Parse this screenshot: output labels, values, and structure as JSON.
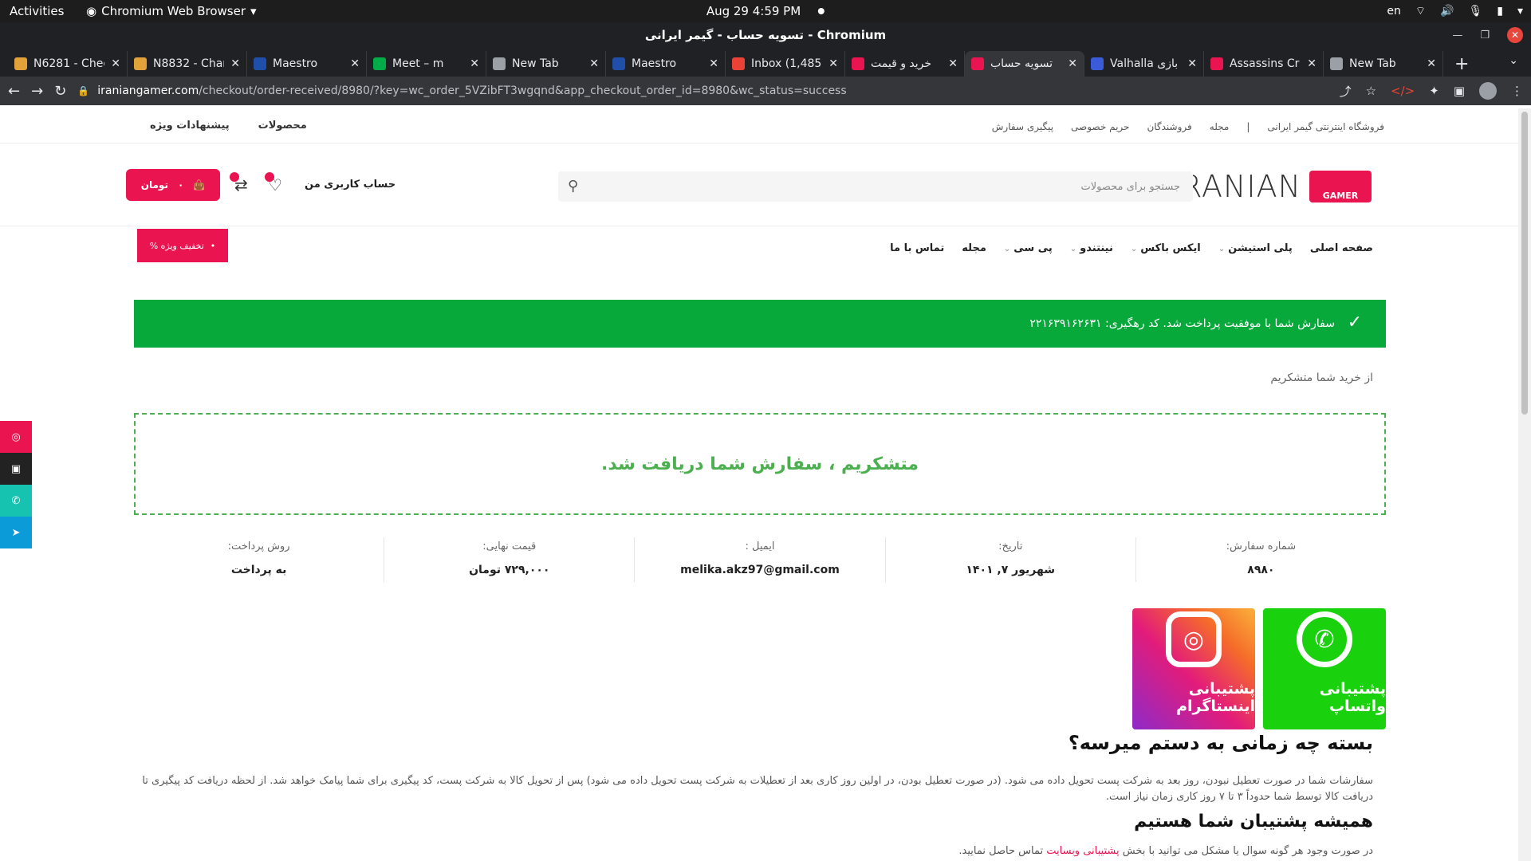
{
  "os_topbar": {
    "activities": "Activities",
    "app": "Chromium Web Browser",
    "clock": "Aug 29  4:59 PM",
    "lang": "en"
  },
  "window": {
    "title": "تسویه حساب - گیمر ایرانی - Chromium"
  },
  "tabs": [
    {
      "label": "N6281 - Chec",
      "color": "#e3a13a"
    },
    {
      "label": "N8832 - Char",
      "color": "#e3a13a"
    },
    {
      "label": "Maestro",
      "color": "#1f4fa8"
    },
    {
      "label": "Meet – m",
      "color": "#00ac47"
    },
    {
      "label": "New Tab",
      "color": "#9aa0a6"
    },
    {
      "label": "Maestro",
      "color": "#1f4fa8"
    },
    {
      "label": "Inbox (1,485",
      "color": "#ea4335"
    },
    {
      "label": "خرید و قیمت",
      "color": "#ea1450"
    },
    {
      "label": "تسویه حساب",
      "color": "#ea1450"
    },
    {
      "label": "Valhalla بازی",
      "color": "#3b5bdb"
    },
    {
      "label": "Assassins Cr",
      "color": "#ea1450"
    },
    {
      "label": "New Tab",
      "color": "#9aa0a6"
    }
  ],
  "omnibox": {
    "host": "iraniangamer.com",
    "path": "/checkout/order-received/8980/?key=wc_order_5VZibFT3wgqnd&app_checkout_order_id=8980&wc_status=success"
  },
  "top_links": {
    "right": [
      "فروشگاه اینترنتی گیمر ایرانی",
      "|",
      "مجله",
      "فروشندگان",
      "حریم خصوصی",
      "پیگیری سفارش"
    ],
    "left": [
      "پیشنهادات ویژه",
      "محصولات"
    ]
  },
  "header": {
    "logo_text": "IRANIAN",
    "logo_badge": "GAMER",
    "search_placeholder": "جستجو برای محصولات",
    "account": "حساب کاربری من",
    "cart_label": "تومان",
    "cart_count": "۰"
  },
  "main_nav": [
    "صفحه اصلی",
    "پلی استیشن",
    "ایکس باکس",
    "نینتندو",
    "پی سی",
    "مجله",
    "تماس با ما"
  ],
  "discount_label": "% تخفیف ویژه",
  "notice": "سفارش شما با موفقیت پرداخت شد. کد رهگیری: ۲۲۱۶۳۹۱۶۲۶۳۱",
  "thanks_line": "از خرید شما متشکریم",
  "thanks_box": "متشکریم ، سفارش شما دریافت شد.",
  "overview": [
    {
      "label": "شماره سفارش:",
      "value": "۸۹۸۰"
    },
    {
      "label": "تاریخ:",
      "value": "شهریور ۷, ۱۴۰۱"
    },
    {
      "label": "ایمیل :",
      "value": "melika.akz97@gmail.com"
    },
    {
      "label": "قیمت نهایی:",
      "value": "۷۲۹,۰۰۰ تومان"
    },
    {
      "label": "روش پرداخت:",
      "value": "به پرداخت"
    }
  ],
  "support": {
    "whatsapp": "پشتیبانی واتساپ",
    "instagram": "پشتیبانی اینستاگرام"
  },
  "delivery": {
    "heading": "بسته چه زمانی به دستم میرسه؟",
    "text": "سفارشات شما در صورت تعطیل نبودن، روز بعد به شرکت پست تحویل داده می شود. (در صورت تعطیل بودن، در اولین روز کاری بعد از تعطیلات به شرکت پست تحویل داده می شود) پس از تحویل کالا به شرکت پست، کد پیگیری برای شما پیامک خواهد شد. از لحظه دریافت کد پیگیری تا دریافت کالا توسط شما حدوداً ۳ تا ۷ روز کاری زمان نیاز است."
  },
  "support_section": {
    "heading": "همیشه پشتیبان شما هستیم",
    "text_start": "در صورت وجود هر گونه سوال یا مشکل می توانید با بخش",
    "link": "پشتیبانی وبسایت",
    "text_end": "تماس حاصل نمایید."
  },
  "colors": {
    "brand": "#ea1450",
    "success": "#07a93b",
    "whatsapp": "#19d10d"
  }
}
